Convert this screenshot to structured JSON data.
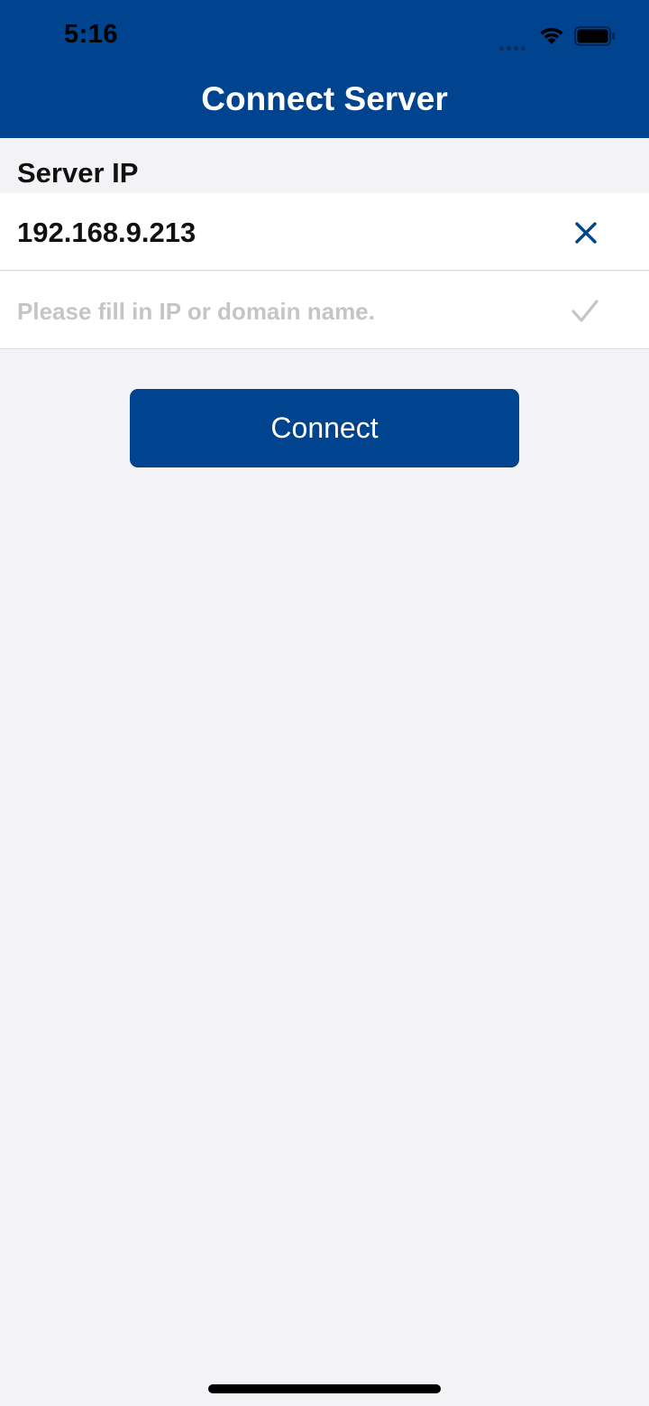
{
  "status_bar": {
    "time": "5:16",
    "signal_icon": "cellular-signal-icon",
    "wifi_icon": "wifi-icon",
    "battery_icon": "battery-icon"
  },
  "nav": {
    "title": "Connect Server"
  },
  "server_ip": {
    "section_label": "Server IP",
    "current_value": "192.168.9.213",
    "clear_icon": "close-icon",
    "input_value": "",
    "input_placeholder": "Please fill in IP or domain name.",
    "confirm_icon": "checkmark-icon"
  },
  "actions": {
    "connect_label": "Connect"
  },
  "colors": {
    "brand_blue": "#00438e",
    "background": "#f3f3f5",
    "placeholder_gray": "#c5c5c8"
  }
}
